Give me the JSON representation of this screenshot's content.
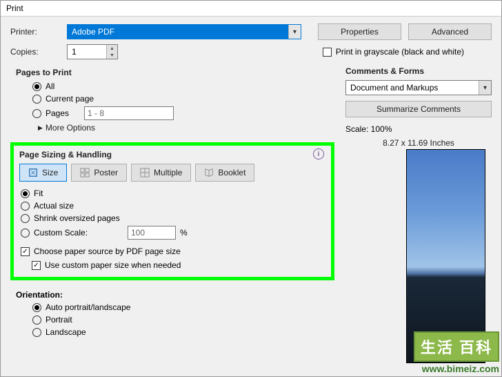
{
  "window": {
    "title": "Print"
  },
  "printer": {
    "label": "Printer:",
    "value": "Adobe PDF",
    "properties_btn": "Properties",
    "advanced_btn": "Advanced"
  },
  "copies": {
    "label": "Copies:",
    "value": "1",
    "grayscale_label": "Print in grayscale (black and white)"
  },
  "pages_to_print": {
    "title": "Pages to Print",
    "all": "All",
    "current": "Current page",
    "pages": "Pages",
    "pages_value": "1 - 8",
    "more_options": "More Options"
  },
  "page_sizing": {
    "title": "Page Sizing & Handling",
    "tabs": {
      "size": "Size",
      "poster": "Poster",
      "multiple": "Multiple",
      "booklet": "Booklet"
    },
    "fit": "Fit",
    "actual": "Actual size",
    "shrink": "Shrink oversized pages",
    "custom_scale": "Custom Scale:",
    "custom_scale_value": "100",
    "percent": "%",
    "choose_paper": "Choose paper source by PDF page size",
    "use_custom": "Use custom paper size when needed"
  },
  "orientation": {
    "title": "Orientation:",
    "auto": "Auto portrait/landscape",
    "portrait": "Portrait",
    "landscape": "Landscape"
  },
  "comments_forms": {
    "title": "Comments & Forms",
    "value": "Document and Markups",
    "summarize_btn": "Summarize Comments"
  },
  "preview": {
    "scale": "Scale: 100%",
    "dimensions": "8.27 x 11.69 Inches"
  },
  "watermark": {
    "cn": "生活 百科",
    "url": "www.bimeiz.com"
  }
}
